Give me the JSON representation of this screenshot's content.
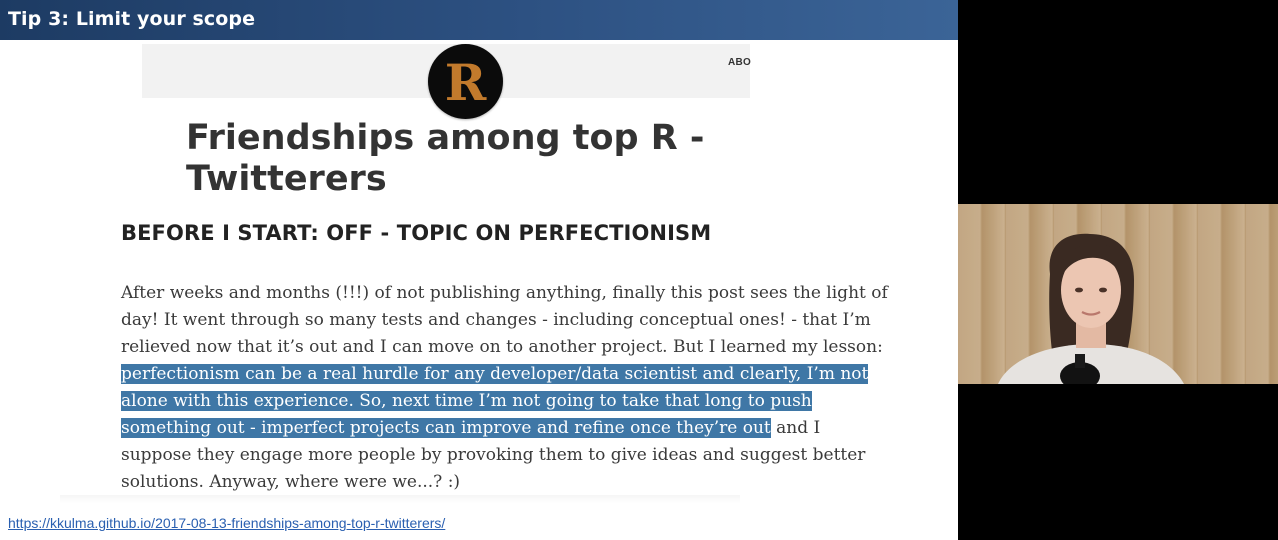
{
  "slide": {
    "title": "Tip 3: Limit your scope",
    "source_url": "https://kkulma.github.io/2017-08-13-friendships-among-top-r-twitterers/"
  },
  "blog": {
    "logo_letter": "R",
    "nav_item": "ABO",
    "post_title_line1": "Friendships among top R -",
    "post_title_line2": "Twitterers",
    "section_heading": "BEFORE I START: OFF - TOPIC ON PERFECTIONISM",
    "paragraph": {
      "line1": "After weeks and months (!!!) of not publishing anything, finally this post sees the light of",
      "line2": "day! It went through so many tests and changes - including conceptual ones! - that I’m",
      "line3": "relieved now that it’s out and I can move on to another project. But I learned my lesson:",
      "line4_highlighted": "perfectionism can be a real hurdle for any developer/data scientist and clearly, I’m not",
      "line5_highlighted": "alone with this experience. So, next time I’m not going to take that long to push",
      "line6_highlighted": "something out - imperfect projects can improve and refine once they’re out",
      "line6_rest": " and I",
      "line7": "suppose they engage more people by provoking them to give ideas and suggest better",
      "line8": "solutions. Anyway, where were we...? :)"
    }
  },
  "colors": {
    "header_bar": "#2d5182",
    "highlight": "#3f77a6",
    "link": "#2a5fb0",
    "logo_letter": "#c27a2c"
  }
}
